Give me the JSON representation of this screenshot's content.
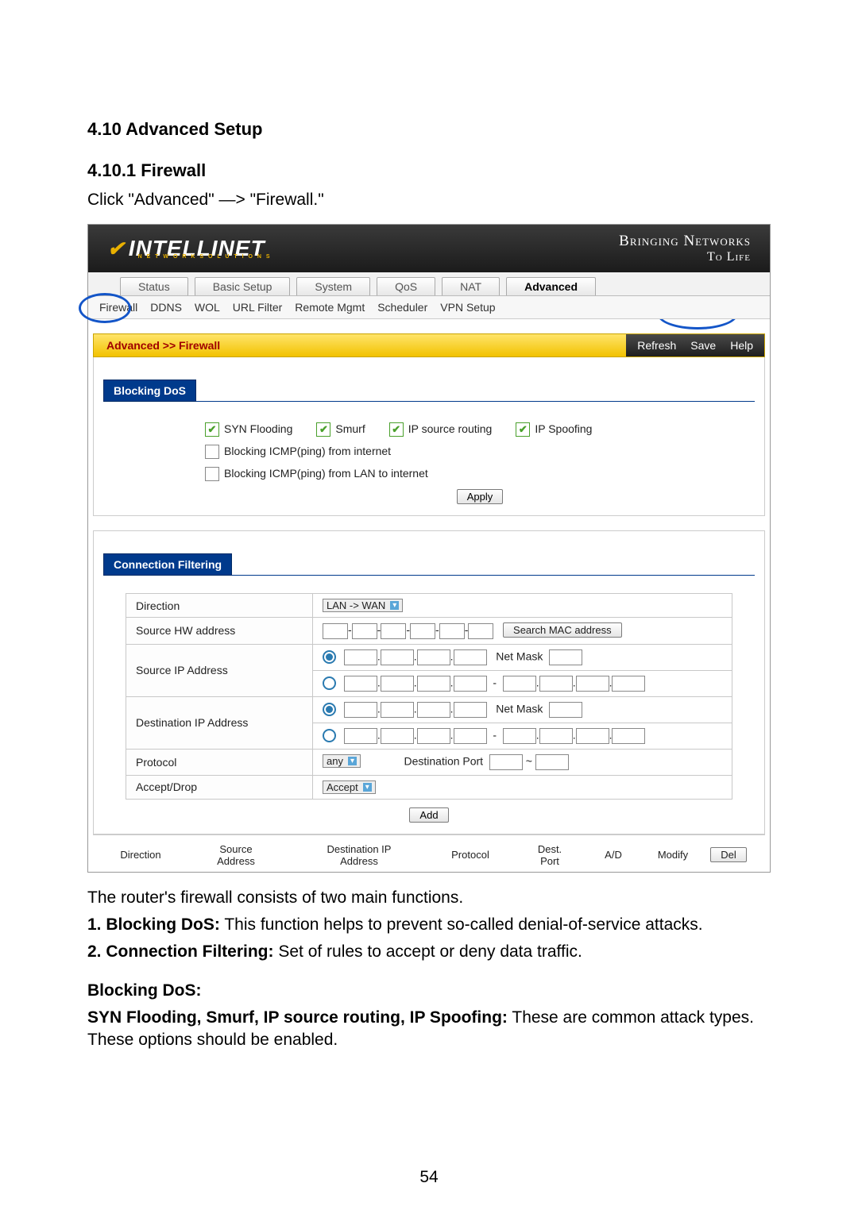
{
  "doc": {
    "h1": "4.10 Advanced Setup",
    "h2": "4.10.1 Firewall",
    "intro": "Click \"Advanced\" —> \"Firewall.\"",
    "page_number": "54"
  },
  "banner": {
    "brand": "INTELLINET",
    "brand_sub": "N E T W O R K  S O L U T I O N S",
    "tagline1": "Bringing Networks",
    "tagline2": "To Life"
  },
  "main_tabs": [
    "Status",
    "Basic Setup",
    "System",
    "QoS",
    "NAT",
    "Advanced"
  ],
  "sub_tabs": [
    "Firewall",
    "DDNS",
    "WOL",
    "URL Filter",
    "Remote Mgmt",
    "Scheduler",
    "VPN Setup"
  ],
  "crumb": "Advanced >> Firewall",
  "crumb_actions": [
    "Refresh",
    "Save",
    "Help"
  ],
  "sections": {
    "dos_title": "Blocking DoS",
    "dos_checks": {
      "syn": "SYN Flooding",
      "smurf": "Smurf",
      "ipsrc": "IP source routing",
      "ipspoof": "IP Spoofing",
      "icmp_net": "Blocking ICMP(ping) from internet",
      "icmp_lan": "Blocking ICMP(ping) from LAN to internet"
    },
    "apply": "Apply",
    "cf_title": "Connection Filtering",
    "cf": {
      "direction_label": "Direction",
      "direction_value": "LAN -> WAN",
      "hw_label": "Source HW address",
      "search_mac": "Search MAC address",
      "srcip_label": "Source IP Address",
      "netmask": "Net Mask",
      "dstip_label": "Destination IP Address",
      "proto_label": "Protocol",
      "proto_value": "any",
      "dstport_label": "Destination Port",
      "tilde": "~",
      "accept_label": "Accept/Drop",
      "accept_value": "Accept",
      "add": "Add"
    },
    "list_headers": {
      "dir": "Direction",
      "src": "Source\nAddress",
      "dst": "Destination IP\nAddress",
      "proto": "Protocol",
      "port": "Dest.\nPort",
      "ad": "A/D",
      "mod": "Modify",
      "del": "Del"
    }
  },
  "desc": {
    "line1": "The router's firewall consists of two main functions.",
    "b1_label": "1. Blocking DoS:",
    "b1_text": " This function helps to prevent so-called denial-of-service attacks.",
    "b2_label": "2. Connection Filtering:",
    "b2_text": " Set of rules to accept or deny data traffic.",
    "h3": "Blocking DoS:",
    "b3_label": "SYN Flooding, Smurf, IP source routing, IP Spoofing:",
    "b3_text": " These are common attack types. These options should be enabled."
  }
}
